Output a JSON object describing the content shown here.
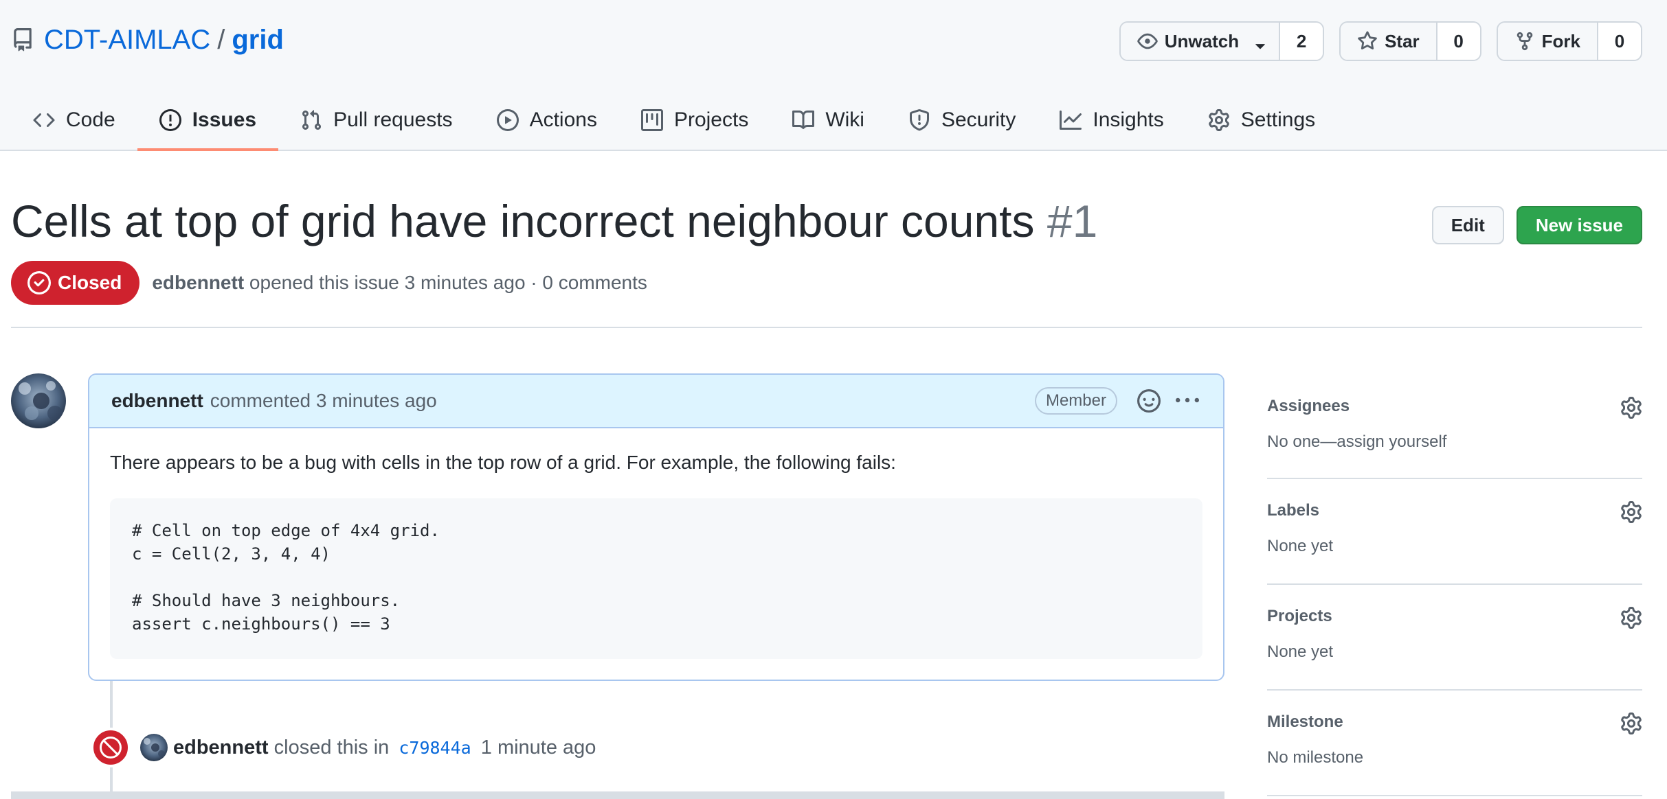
{
  "repo": {
    "owner": "CDT-AIMLAC",
    "separator": "/",
    "name": "grid",
    "unwatch_label": "Unwatch",
    "watch_count": "2",
    "star_label": "Star",
    "star_count": "0",
    "fork_label": "Fork",
    "fork_count": "0"
  },
  "nav": {
    "items": [
      {
        "label": "Code",
        "icon": "code-icon"
      },
      {
        "label": "Issues",
        "icon": "issue-opened-icon",
        "selected": true
      },
      {
        "label": "Pull requests",
        "icon": "pull-request-icon"
      },
      {
        "label": "Actions",
        "icon": "play-icon"
      },
      {
        "label": "Projects",
        "icon": "project-icon"
      },
      {
        "label": "Wiki",
        "icon": "book-icon"
      },
      {
        "label": "Security",
        "icon": "shield-icon"
      },
      {
        "label": "Insights",
        "icon": "graph-icon"
      },
      {
        "label": "Settings",
        "icon": "gear-icon"
      }
    ]
  },
  "issue": {
    "title": "Cells at top of grid have incorrect neighbour counts",
    "number": "#1",
    "edit_label": "Edit",
    "new_issue_label": "New issue",
    "state": "Closed",
    "author": "edbennett",
    "meta_rest": "opened this issue 3 minutes ago · 0 comments"
  },
  "comment": {
    "author": "edbennett",
    "action": "commented 3 minutes ago",
    "badge": "Member",
    "body": "There appears to be a bug with cells in the top row of a grid. For example, the following fails:",
    "code": "# Cell on top edge of 4x4 grid.\nc = Cell(2, 3, 4, 4)\n\n# Should have 3 neighbours.\nassert c.neighbours() == 3"
  },
  "event": {
    "author": "edbennett",
    "action": "closed this in",
    "commit": "c79844a",
    "time": "1 minute ago"
  },
  "sidebar": {
    "sections": [
      {
        "heading": "Assignees",
        "value": "No one—assign yourself"
      },
      {
        "heading": "Labels",
        "value": "None yet"
      },
      {
        "heading": "Projects",
        "value": "None yet"
      },
      {
        "heading": "Milestone",
        "value": "No milestone"
      }
    ]
  },
  "colors": {
    "link": "#0969da",
    "closed": "#cf222e",
    "primary_button": "#2da44e",
    "selected_tab_underline": "#fd8c73"
  }
}
